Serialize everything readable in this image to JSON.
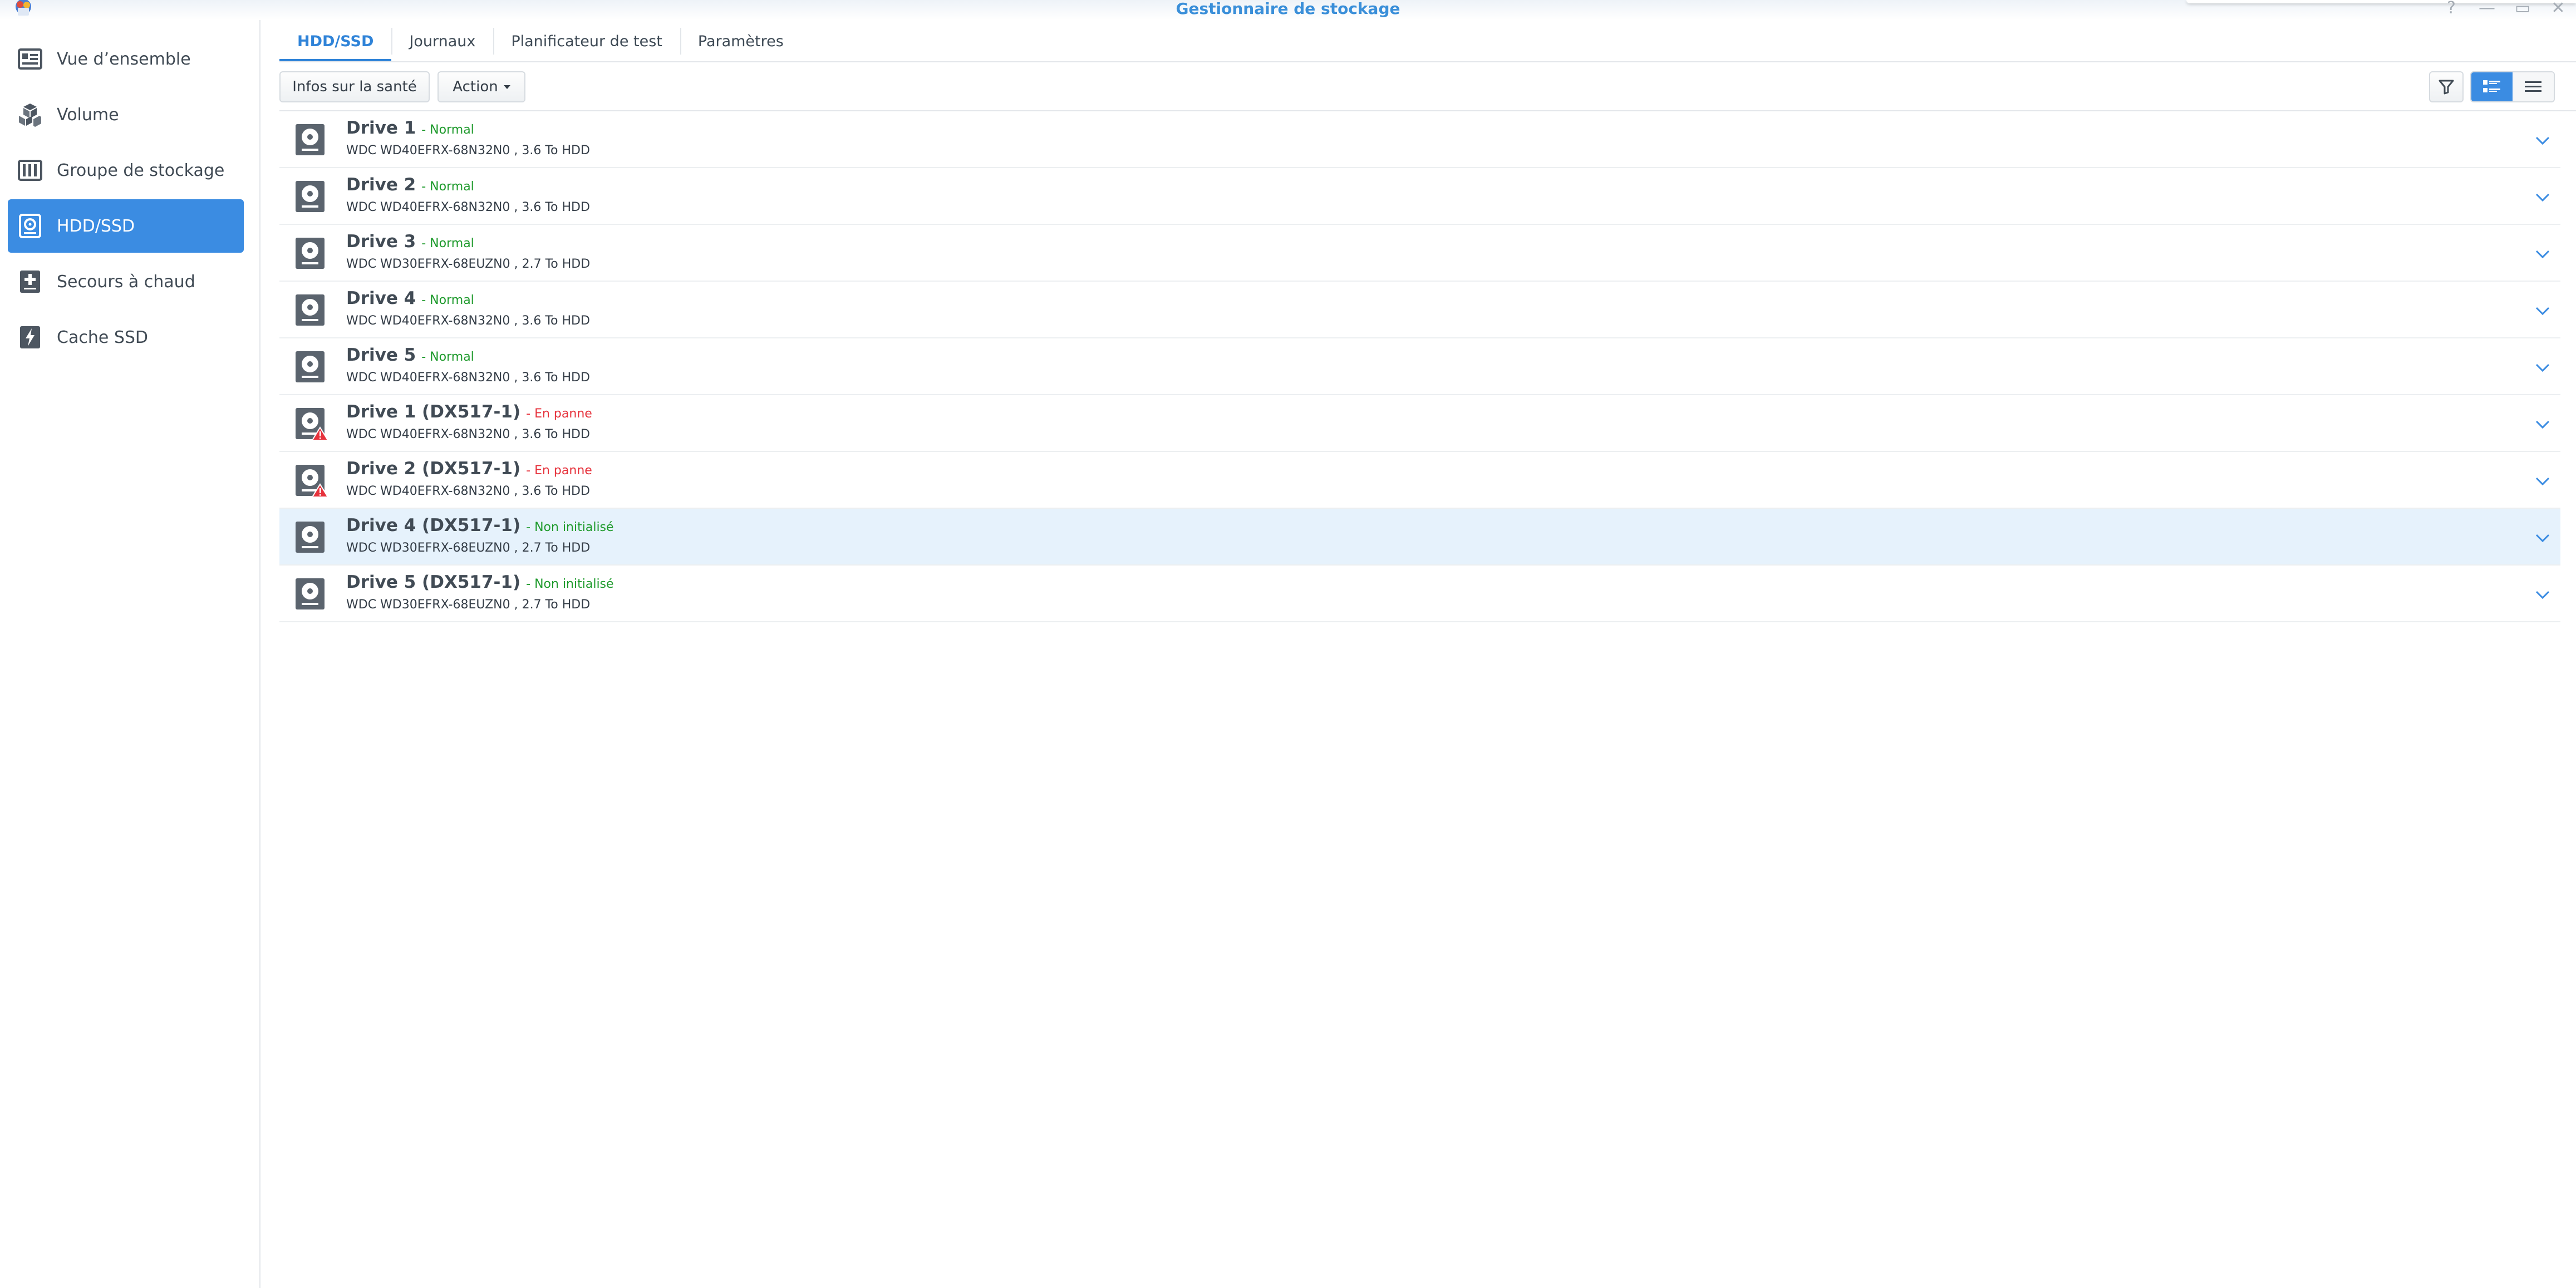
{
  "window": {
    "title": "Gestionnaire de stockage",
    "buttons": [
      "?",
      "—",
      "▭",
      "✕"
    ]
  },
  "sidebar": {
    "items": [
      {
        "label": "Vue d’ensemble",
        "icon": "overview-icon",
        "active": false
      },
      {
        "label": "Volume",
        "icon": "volume-icon",
        "active": false
      },
      {
        "label": "Groupe de stockage",
        "icon": "storage-pool-icon",
        "active": false
      },
      {
        "label": "HDD/SSD",
        "icon": "hdd-icon",
        "active": true
      },
      {
        "label": "Secours à chaud",
        "icon": "hot-spare-icon",
        "active": false
      },
      {
        "label": "Cache SSD",
        "icon": "ssd-cache-icon",
        "active": false
      }
    ]
  },
  "tabs": [
    {
      "label": "HDD/SSD",
      "active": true
    },
    {
      "label": "Journaux",
      "active": false
    },
    {
      "label": "Planificateur de test",
      "active": false
    },
    {
      "label": "Paramètres",
      "active": false
    }
  ],
  "toolbar": {
    "health_label": "Infos sur la santé",
    "action_label": "Action",
    "filter_icon": "filter-icon",
    "view_modes": [
      "list-detail-icon",
      "list-compact-icon"
    ],
    "active_view": "list-detail-icon"
  },
  "colors": {
    "accent": "#3b8ce2",
    "status_normal": "#1e9a2c",
    "status_failed": "#e6323c",
    "selected_row": "#e6f2fc"
  },
  "drives": [
    {
      "name": "Drive 1",
      "status": "- Normal",
      "state": "ok",
      "detail": "WDC WD40EFRX-68N32N0 , 3.6 To HDD",
      "warning": false,
      "selected": false
    },
    {
      "name": "Drive 2",
      "status": "- Normal",
      "state": "ok",
      "detail": "WDC WD40EFRX-68N32N0 , 3.6 To HDD",
      "warning": false,
      "selected": false
    },
    {
      "name": "Drive 3",
      "status": "- Normal",
      "state": "ok",
      "detail": "WDC WD30EFRX-68EUZN0 , 2.7 To HDD",
      "warning": false,
      "selected": false
    },
    {
      "name": "Drive 4",
      "status": "- Normal",
      "state": "ok",
      "detail": "WDC WD40EFRX-68N32N0 , 3.6 To HDD",
      "warning": false,
      "selected": false
    },
    {
      "name": "Drive 5",
      "status": "- Normal",
      "state": "ok",
      "detail": "WDC WD40EFRX-68N32N0 , 3.6 To HDD",
      "warning": false,
      "selected": false
    },
    {
      "name": "Drive 1 (DX517-1)",
      "status": "- En panne",
      "state": "bad",
      "detail": "WDC WD40EFRX-68N32N0 , 3.6 To HDD",
      "warning": true,
      "selected": false
    },
    {
      "name": "Drive 2 (DX517-1)",
      "status": "- En panne",
      "state": "bad",
      "detail": "WDC WD40EFRX-68N32N0 , 3.6 To HDD",
      "warning": true,
      "selected": false
    },
    {
      "name": "Drive 4 (DX517-1)",
      "status": "- Non initialisé",
      "state": "ok",
      "detail": "WDC WD30EFRX-68EUZN0 , 2.7 To HDD",
      "warning": false,
      "selected": true
    },
    {
      "name": "Drive 5 (DX517-1)",
      "status": "- Non initialisé",
      "state": "ok",
      "detail": "WDC WD30EFRX-68EUZN0 , 2.7 To HDD",
      "warning": false,
      "selected": false
    }
  ]
}
